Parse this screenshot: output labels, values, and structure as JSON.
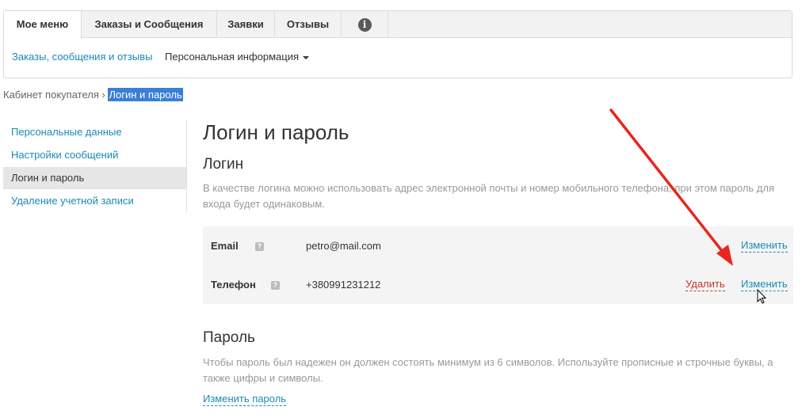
{
  "tabs": [
    {
      "label": "Мое меню",
      "active": true
    },
    {
      "label": "Заказы и Сообщения",
      "active": false
    },
    {
      "label": "Заявки",
      "active": false
    },
    {
      "label": "Отзывы",
      "active": false
    }
  ],
  "info_tab_icon": "info-icon",
  "subnav": {
    "orders_link": "Заказы, сообщения и отзывы",
    "personal_dropdown": "Персональная информация"
  },
  "breadcrumb": {
    "parent": "Кабинет покупателя",
    "separator": "›",
    "current": "Логин и пароль"
  },
  "sidebar": {
    "items": [
      {
        "label": "Персональные данные",
        "active": false
      },
      {
        "label": "Настройки сообщений",
        "active": false
      },
      {
        "label": "Логин и пароль",
        "active": true
      },
      {
        "label": "Удаление учетной записи",
        "active": false
      }
    ]
  },
  "main": {
    "title": "Логин и пароль",
    "login_section": {
      "heading": "Логин",
      "note": "В качестве логина можно использовать адрес электронной почты и номер мобильного телефона, при этом пароль для входа будет одинаковым."
    },
    "rows": [
      {
        "label": "Email",
        "value": "petro@mail.com",
        "edit": "Изменить"
      },
      {
        "label": "Телефон",
        "value": "+380991231212",
        "delete": "Удалить",
        "edit": "Изменить"
      }
    ],
    "password_section": {
      "heading": "Пароль",
      "note": "Чтобы пароль был надежен он должен состоять минимум из 6 символов. Используйте прописные и строчные буквы, а также цифры и символы.",
      "change_link": "Изменить пароль"
    }
  },
  "colors": {
    "link": "#1a8ab5",
    "delete": "#c0392b",
    "arrow": "#e8261f",
    "highlight": "#3a7fd5"
  }
}
